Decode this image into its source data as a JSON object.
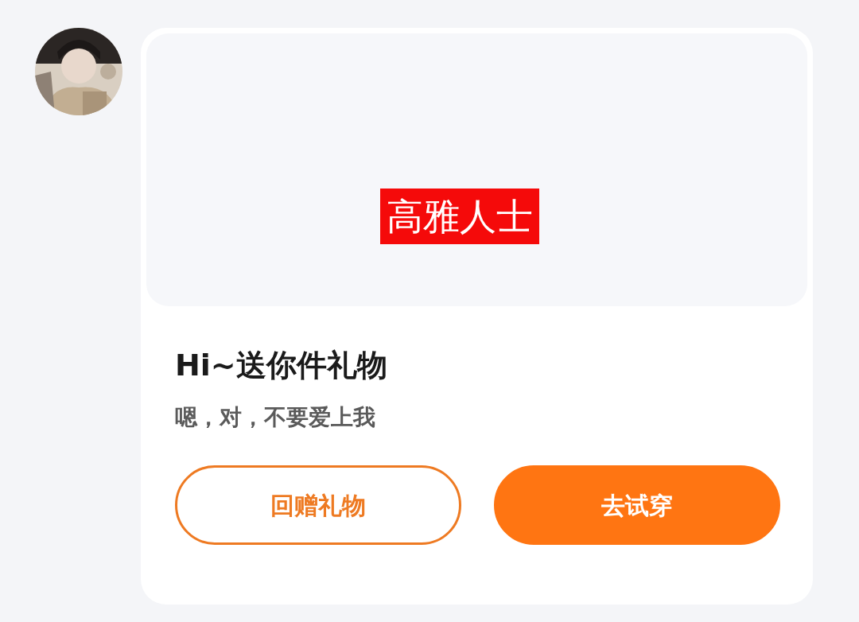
{
  "gift_card": {
    "item_label": "高雅人士",
    "title": "Hi~送你件礼物",
    "message": "嗯，对，不要爱上我",
    "buttons": [
      {
        "label": "回赠礼物",
        "kind": "outline"
      },
      {
        "label": "去试穿",
        "kind": "filled"
      }
    ]
  }
}
